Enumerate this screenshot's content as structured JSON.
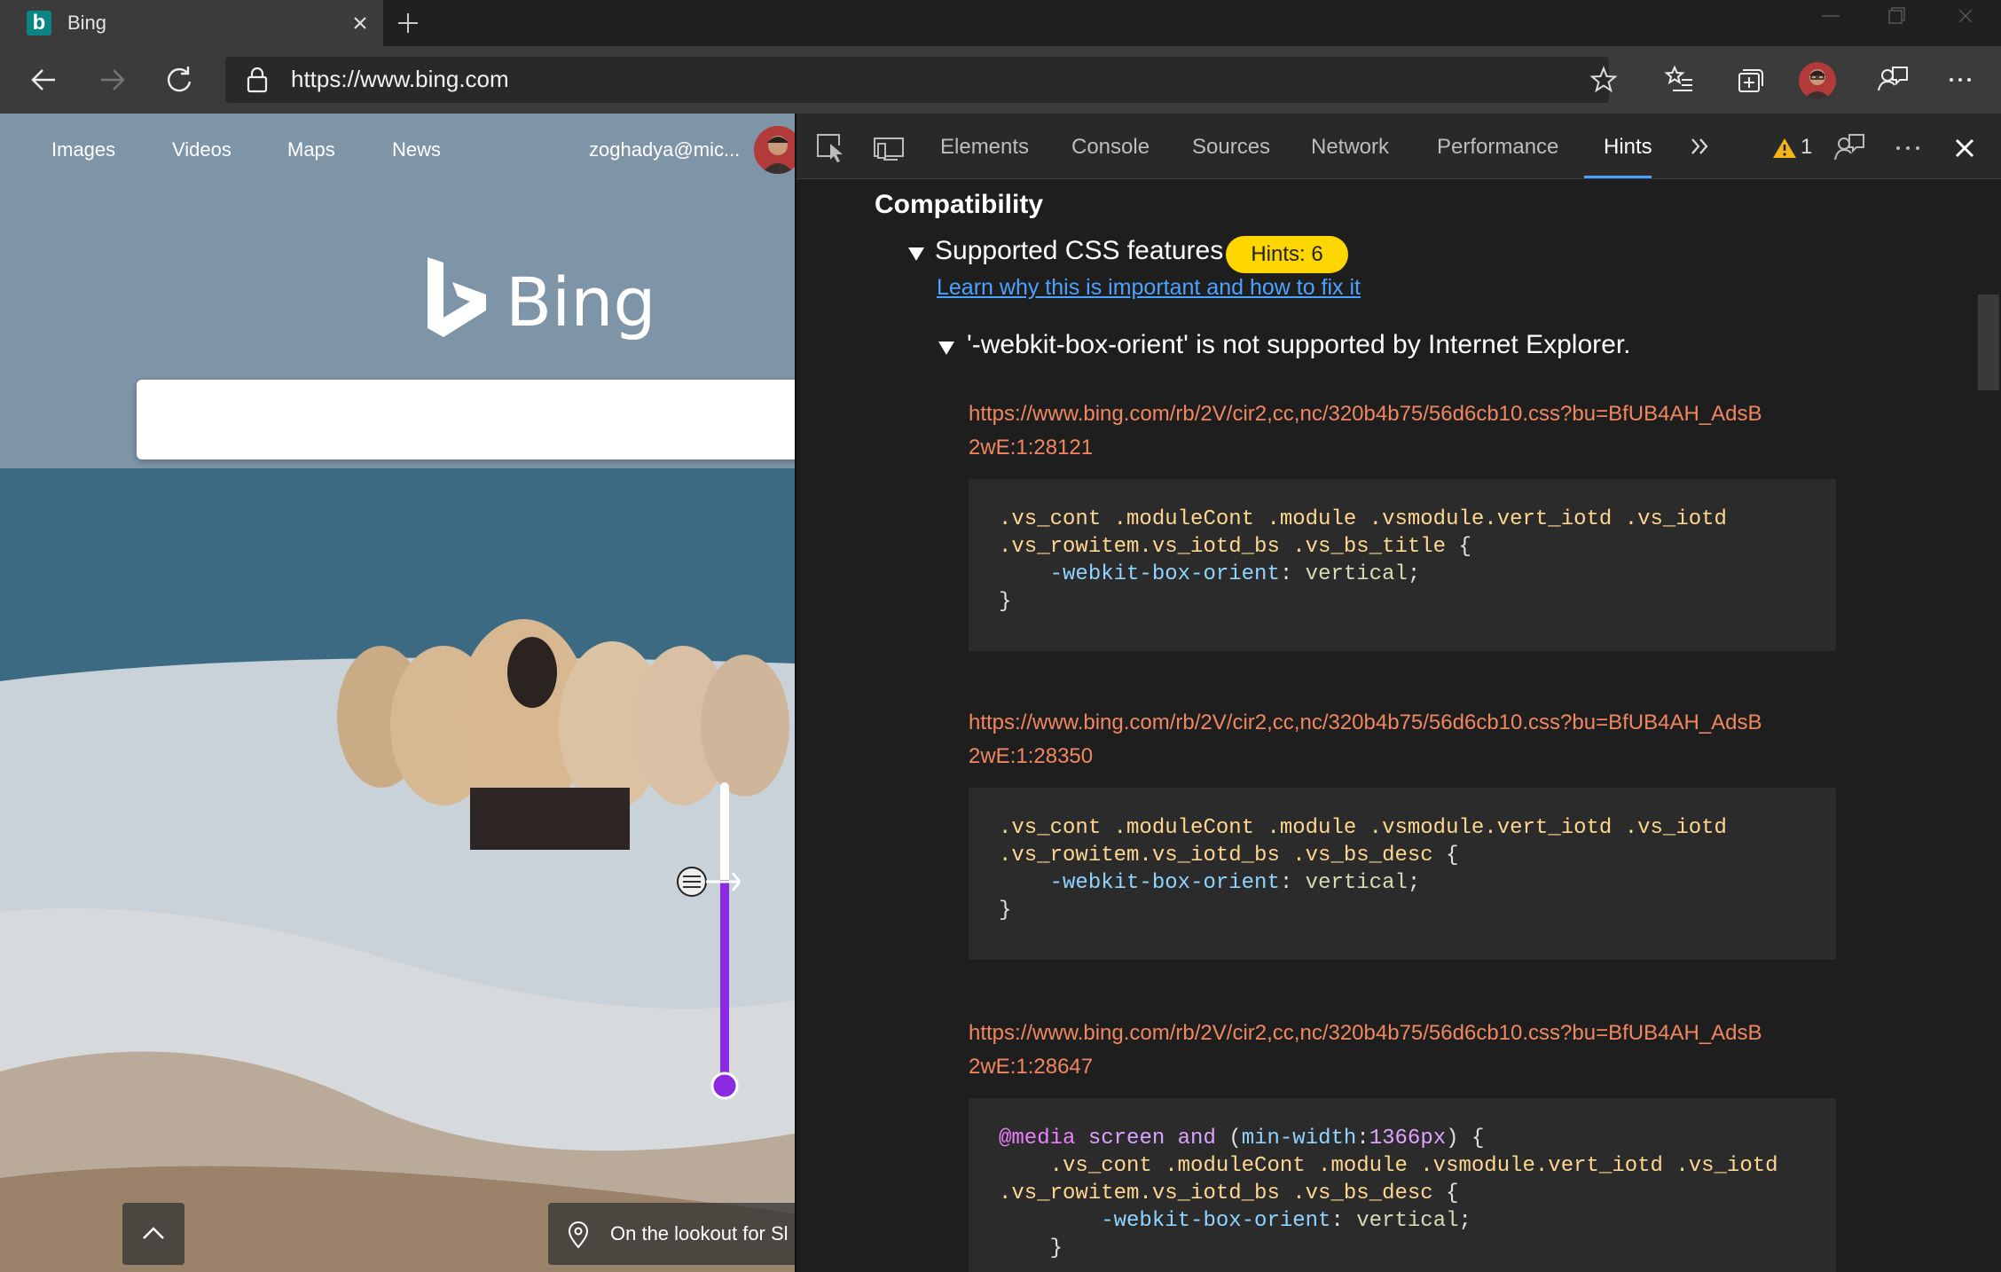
{
  "browser": {
    "tab_title": "Bing",
    "tab_icon_letter": "b",
    "url": "https://www.bing.com"
  },
  "page": {
    "nav": [
      "Images",
      "Videos",
      "Maps",
      "News"
    ],
    "user": "zoghadya@mic...",
    "logo_text": "Bing",
    "caption": "On the lookout for Sl"
  },
  "devtools": {
    "tabs": [
      "Elements",
      "Console",
      "Sources",
      "Network",
      "Performance",
      "Hints"
    ],
    "active_tab": "Hints",
    "warning_count": "1",
    "section_title": "Compatibility",
    "feature_title": "Supported CSS features",
    "hints_badge": "Hints: 6",
    "learn_link": "Learn why this is important and how to fix it",
    "issue_title": "'-webkit-box-orient' is not supported by Internet Explorer.",
    "entries": [
      {
        "link_line1": "https://www.bing.com/rb/2V/cir2,cc,nc/320b4b75/56d6cb10.css?bu=BfUB4AH_AdsB",
        "link_line2": "2wE:1:28121",
        "code": {
          "sel1": ".vs_cont .moduleCont .module .vsmodule.vert_iotd .vs_iotd",
          "sel2": ".vs_rowitem.vs_iotd_bs .vs_bs_title",
          "prop": "-webkit-box-orient",
          "val": "vertical"
        }
      },
      {
        "link_line1": "https://www.bing.com/rb/2V/cir2,cc,nc/320b4b75/56d6cb10.css?bu=BfUB4AH_AdsB",
        "link_line2": "2wE:1:28350",
        "code": {
          "sel1": ".vs_cont .moduleCont .module .vsmodule.vert_iotd .vs_iotd",
          "sel2": ".vs_rowitem.vs_iotd_bs .vs_bs_desc",
          "prop": "-webkit-box-orient",
          "val": "vertical"
        }
      },
      {
        "link_line1": "https://www.bing.com/rb/2V/cir2,cc,nc/320b4b75/56d6cb10.css?bu=BfUB4AH_AdsB",
        "link_line2": "2wE:1:28647",
        "code": {
          "at": "@media",
          "media_kw1": "screen",
          "media_kw2": "and",
          "media_feature": "min-width",
          "media_value": "1366px",
          "sel1": ".vs_cont .moduleCont .module .vsmodule.vert_iotd .vs_iotd",
          "sel2": ".vs_rowitem.vs_iotd_bs .vs_bs_desc",
          "prop": "-webkit-box-orient",
          "val": "vertical"
        }
      }
    ]
  },
  "colors": {
    "accent_link": "#4ba2ff",
    "source_link": "#f08760",
    "hints_badge": "#fdd600",
    "slider_purple": "#8a2be2"
  }
}
